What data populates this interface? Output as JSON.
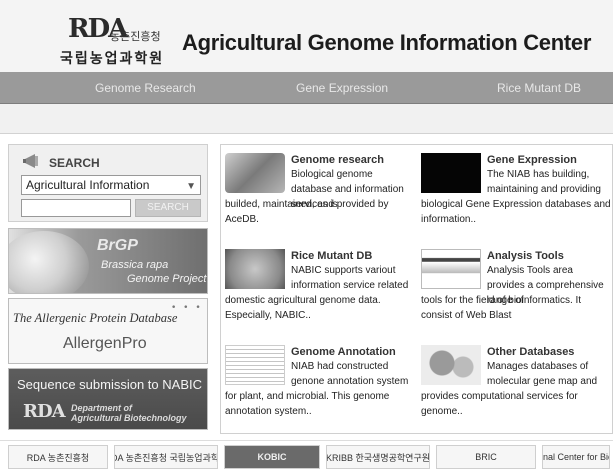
{
  "header": {
    "logo_rda": "RDA",
    "logo_sub": "농촌진흥청",
    "logo_ko": "국립농업과학원",
    "title": "Agricultural Genome Information Center"
  },
  "nav": {
    "items": [
      {
        "label": "Genome Research"
      },
      {
        "label": "Gene Expression"
      },
      {
        "label": "Rice Mutant DB"
      }
    ]
  },
  "search": {
    "title": "SEARCH",
    "select_value": "Agricultural Information",
    "input_value": "",
    "button_label": "SEARCH"
  },
  "banners": {
    "brgp": {
      "title": "BrGP",
      "line1": "Brassica rapa",
      "line2": "Genome Project"
    },
    "allergen": {
      "title": "The Allergenic Protein Database",
      "name": "AllergenPro"
    },
    "submission": {
      "title": "Sequence submission to NABIC",
      "rda": "RDA",
      "dept_line1": "Department of",
      "dept_line2": "Agricultural Biotechnology"
    }
  },
  "sections": [
    {
      "title": "Genome research",
      "desc_a": "Biological genome database and information services is",
      "desc_b": "builded, maintained, and provided by AceDB."
    },
    {
      "title": "Gene Expression",
      "desc_a": "The NIAB has building, maintaining and providing",
      "desc_b": "biological Gene Expression databases and information.."
    },
    {
      "title": "Rice Mutant DB",
      "desc_a": "NABIC supports variout information service related",
      "desc_b": "domestic agricultural genome data. Especially, NABIC.."
    },
    {
      "title": "Analysis Tools",
      "desc_a": "Analysis Tools area provides a comprehensive range of",
      "desc_b": "tools for the field of bioinformatics. It consist of Web Blast"
    },
    {
      "title": "Genome Annotation",
      "desc_a": "NIAB had constructed genone annotation system",
      "desc_b": "for plant, and microbial. This genome annotation system.."
    },
    {
      "title": "Other Databases",
      "desc_a": "Manages databases of molecular gene map and",
      "desc_b": "provides computational services for genome.."
    }
  ],
  "footer": {
    "logos": [
      {
        "text": "RDA 농촌진흥청"
      },
      {
        "text": "RDA 농촌진흥청 국립농업과학원"
      },
      {
        "text": "KOBIC"
      },
      {
        "text": "KRIBB 한국생명공학연구원"
      },
      {
        "text": "BRIC"
      },
      {
        "text": "National Center for Biotech"
      }
    ]
  }
}
